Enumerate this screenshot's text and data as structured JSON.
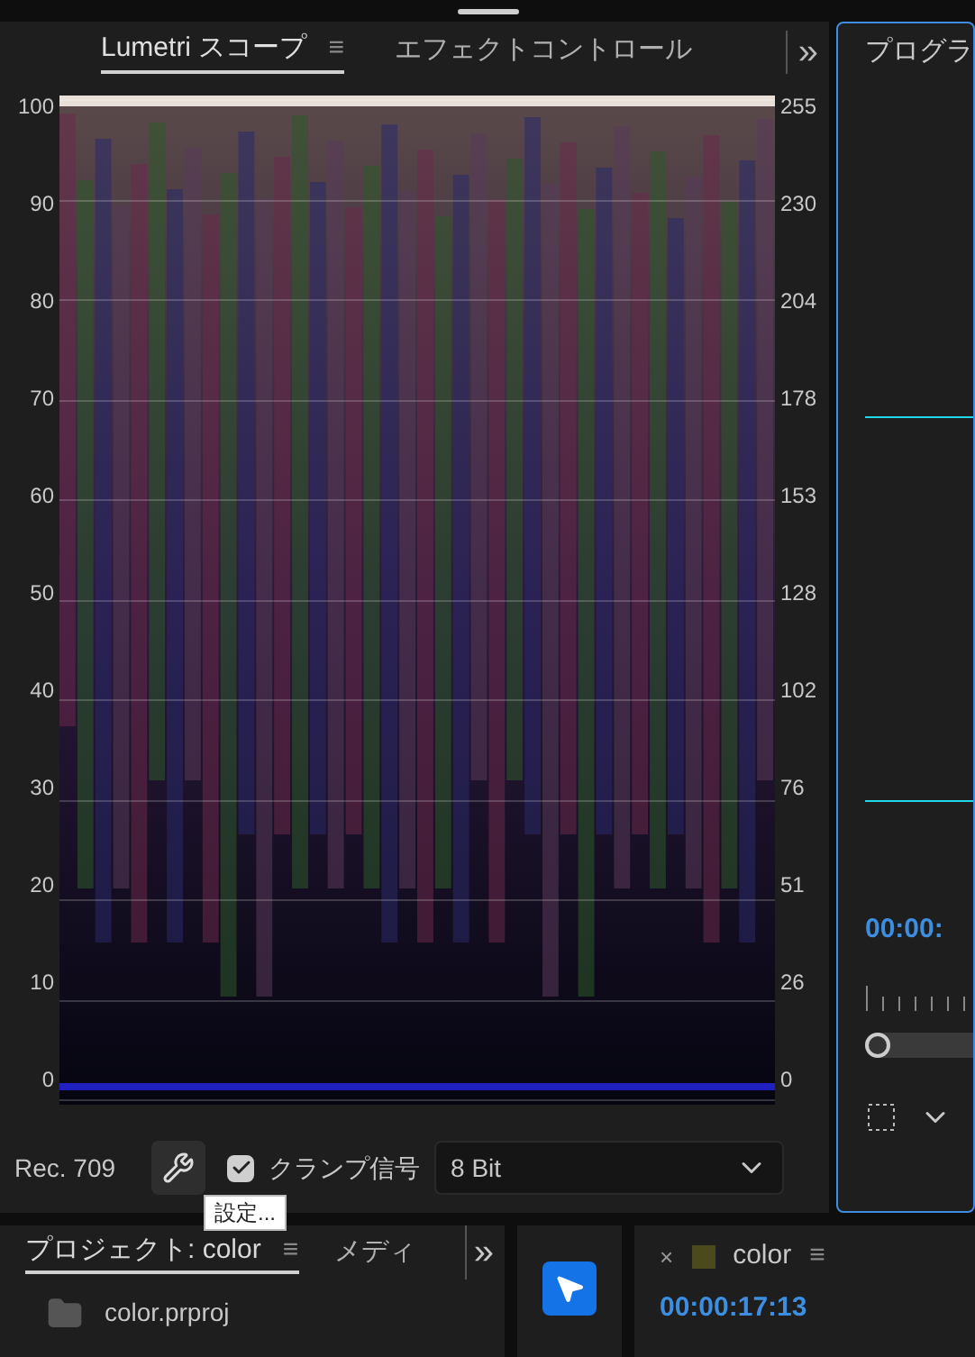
{
  "scope_panel": {
    "tabs": [
      {
        "label": "Lumetri スコープ",
        "selected": true,
        "menu": "≡"
      },
      {
        "label": "エフェクトコントロール",
        "selected": false
      }
    ],
    "overflow": "»",
    "left_scale": [
      "100",
      "90",
      "80",
      "70",
      "60",
      "50",
      "40",
      "30",
      "20",
      "10",
      "0"
    ],
    "right_scale": [
      "255",
      "230",
      "204",
      "178",
      "153",
      "128",
      "102",
      "76",
      "51",
      "26",
      "0"
    ],
    "color_space": "Rec. 709",
    "settings_tooltip": "設定...",
    "clamp": {
      "label": "クランプ信号",
      "checked": true
    },
    "bit_depth": "8 Bit"
  },
  "program_panel": {
    "title": "プログラ",
    "timecode": "00:00:"
  },
  "project_panel": {
    "tabs": [
      {
        "label": "プロジェクト: color",
        "selected": true,
        "menu": "≡"
      },
      {
        "label": "メディ",
        "selected": false
      }
    ],
    "overflow": "»",
    "items": [
      {
        "name": "color.prproj"
      }
    ]
  },
  "timeline_panel": {
    "close": "×",
    "title": "color",
    "color": "#4a4a1c",
    "menu": "≡",
    "timecode": "00:00:17:13"
  }
}
